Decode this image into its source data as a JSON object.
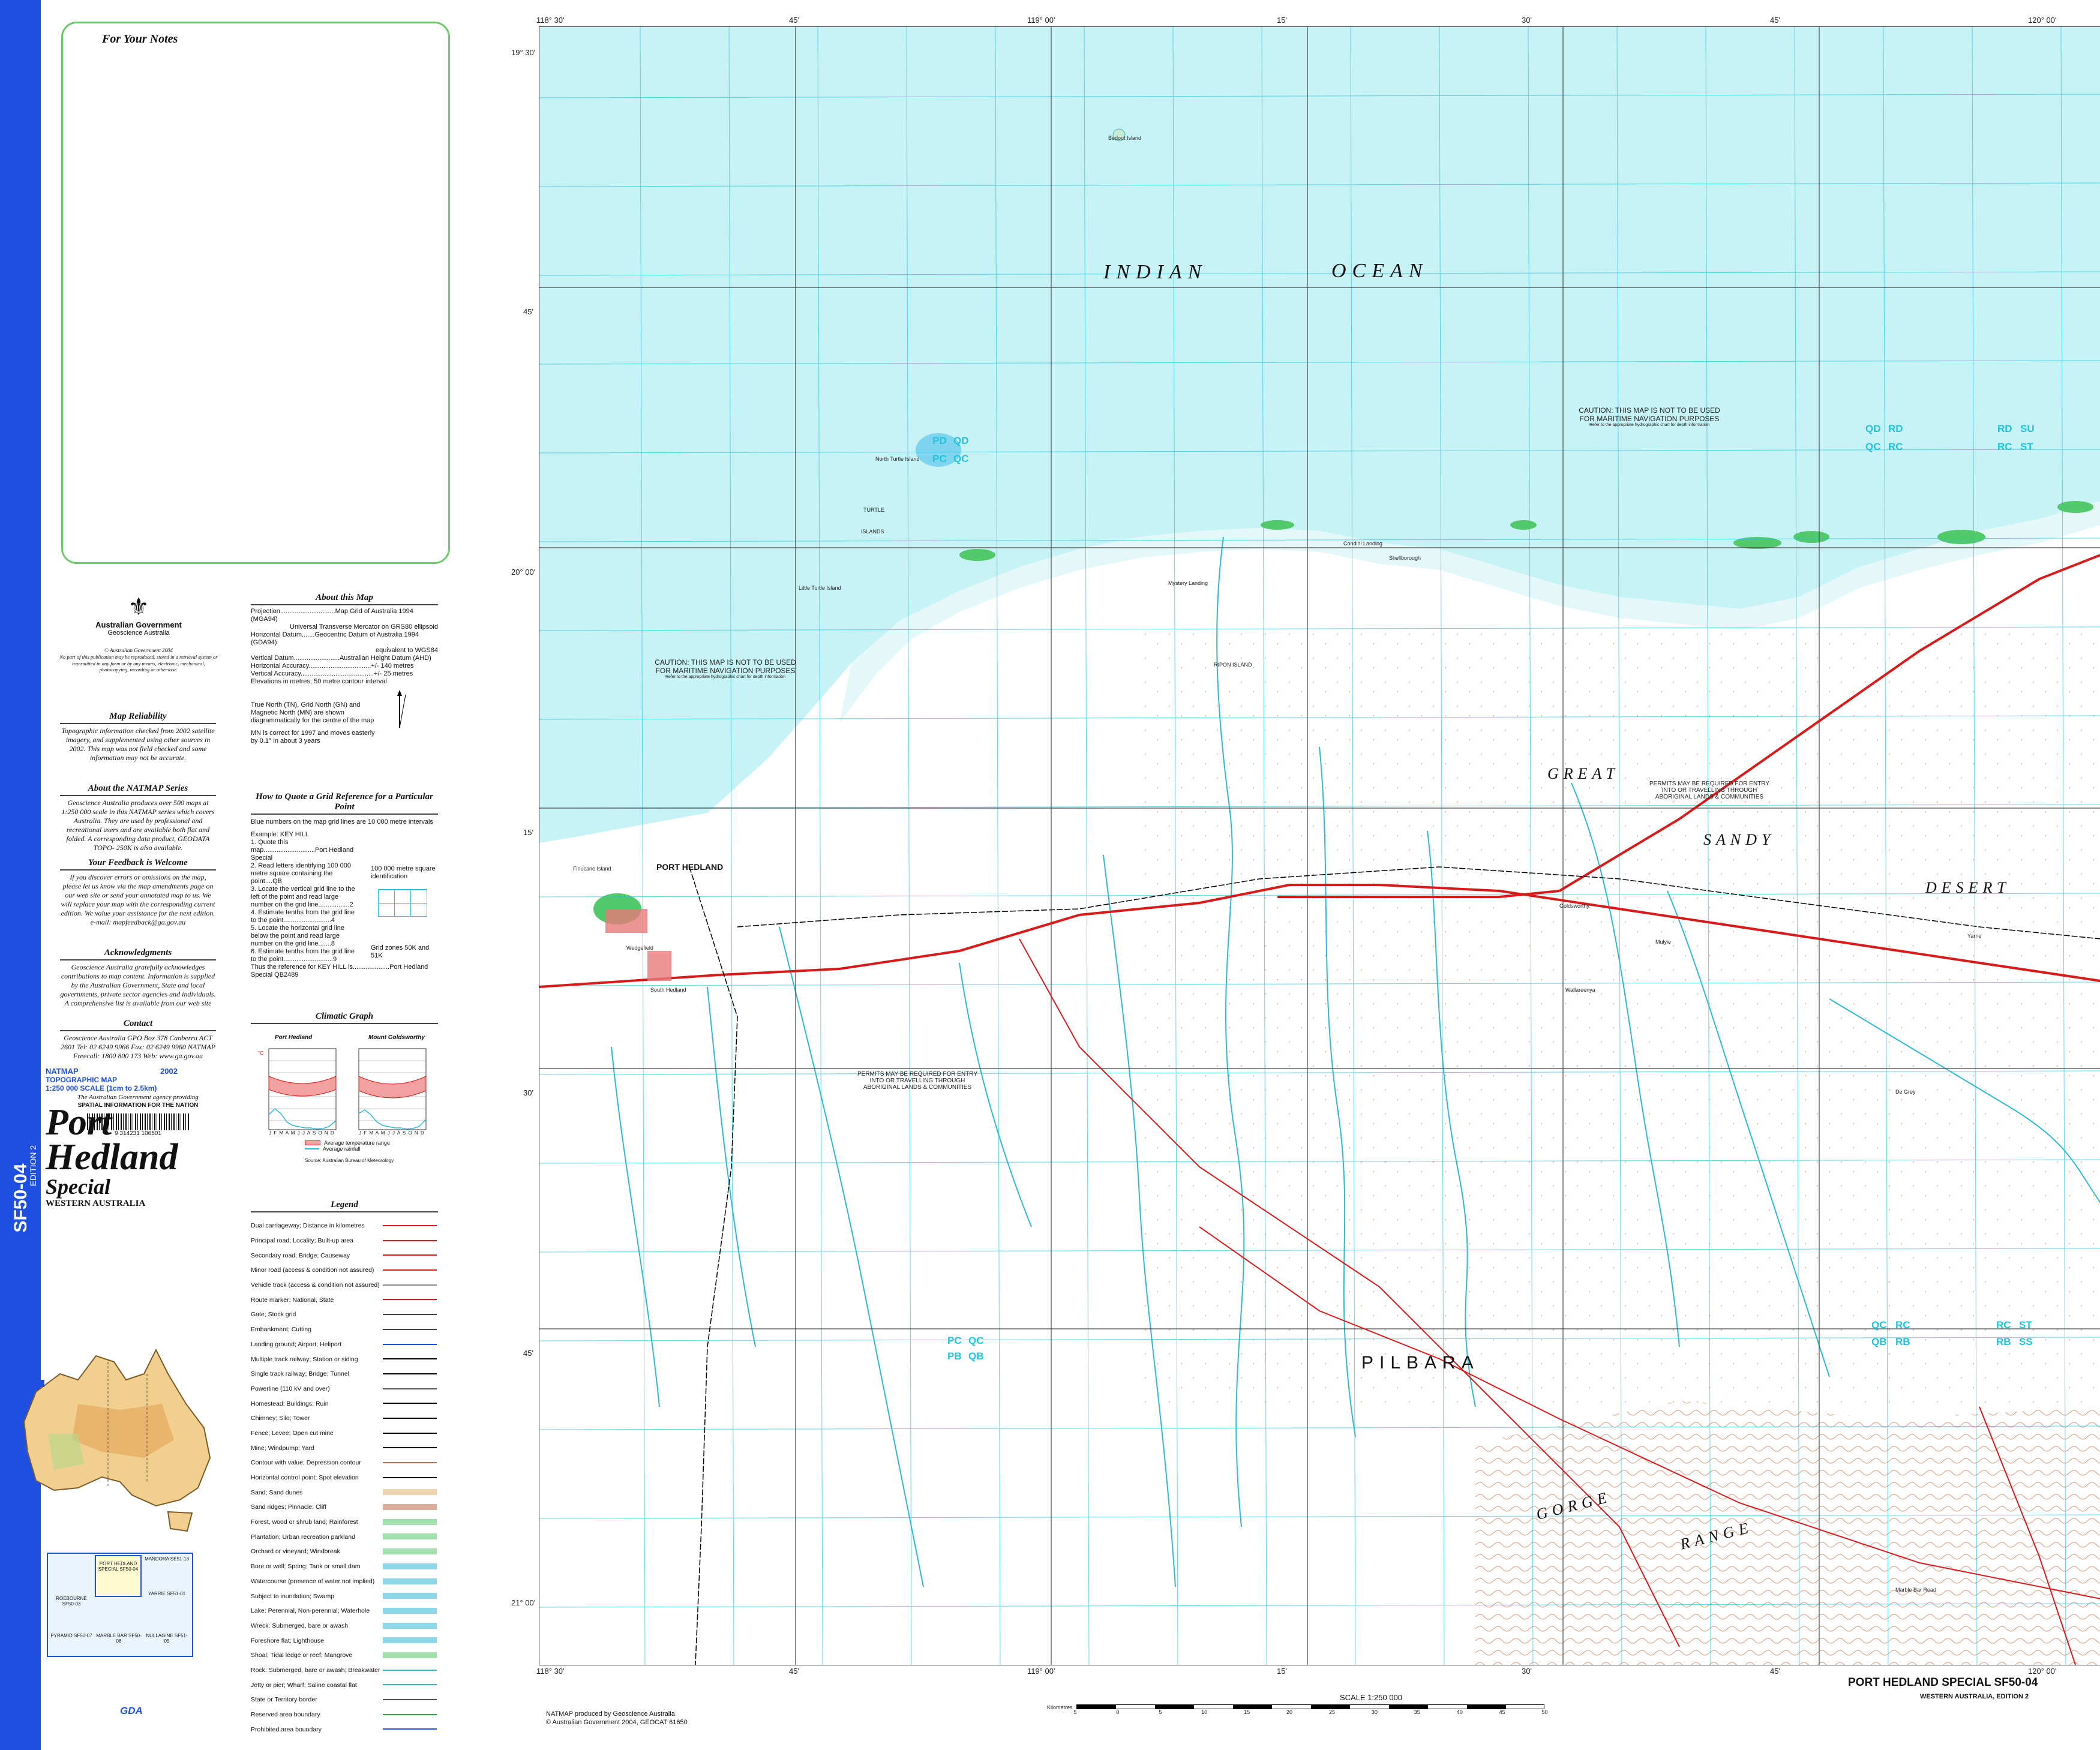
{
  "sheet": {
    "code": "SF50-04",
    "edition": "EDITION 2",
    "series": "NATMAP",
    "map_type": "TOPOGRAPHIC MAP",
    "year": "2002",
    "scale_text": "1:250 000 SCALE (1cm to 2.5km)",
    "title_line1": "Port",
    "title_line2": "Hedland",
    "title_line3": "Special",
    "state": "WESTERN AUSTRALIA",
    "bottom_title": "PORT HEDLAND SPECIAL SF50-04",
    "bottom_subtitle": "WESTERN AUSTRALIA, EDITION 2"
  },
  "notes": {
    "title": "For Your Notes"
  },
  "gov": {
    "line1": "Australian Government",
    "line2": "Geoscience Australia",
    "copyright": "© Australian Government 2004",
    "rights": "No part of this publication may be reproduced, stored in a retrieval system or transmitted in any form or by any means, electronic, mechanical, photocopying, recording or otherwise."
  },
  "panels": [
    {
      "heading": "Map Reliability",
      "body": "Topographic information checked from 2002 satellite imagery, and supplemented using other sources in 2002. This map was not field checked and some information may not be accurate."
    },
    {
      "heading": "About the NATMAP Series",
      "body": "Geoscience Australia produces over 500 maps at 1:250 000 scale in this NATMAP series which covers Australia. They are used by professional and recreational users and are available both flat and folded. A corresponding data product, GEODATA TOPO- 250K is also available."
    },
    {
      "heading": "Your Feedback is Welcome",
      "body": "If you discover errors or omissions on the map, please let us know via the map amendments page on our web site or send your annotated map to us. We will replace your map with the corresponding current edition. We value your assistance for the next edition. e-mail: mapfeedback@ga.gov.au"
    },
    {
      "heading": "Acknowledgments",
      "body": "Geoscience Australia gratefully acknowledges contributions to map content. Information is supplied by the Australian Government, State and local governments, private sector agencies and individuals. A comprehensive list is available from our web site"
    },
    {
      "heading": "Contact",
      "body": "Geoscience Australia GPO Box 378 Canberra ACT 2601 Tel: 02 6249 9966 Fax: 02 6249 9960 NATMAP Freecall: 1800 800 173 Web: www.ga.gov.au"
    }
  ],
  "agency": {
    "line1": "The Australian Government agency providing",
    "line2": "SPATIAL INFORMATION FOR THE NATION",
    "barcode": "9 314231 106501"
  },
  "about": {
    "heading": "About this Map",
    "rows": [
      "Projection..............................Map Grid of Australia 1994 (MGA94)",
      "Universal Transverse Mercator on GRS80 ellipsoid",
      "Horizontal Datum.......Geocentric Datum of Australia 1994 (GDA94)",
      "equivalent to WGS84",
      "Vertical Datum.........................Australian Height Datum (AHD)",
      "Horizontal Accuracy..................................+/- 140 metres",
      "Vertical Accuracy........................................+/- 25 metres",
      "Elevations in metres; 50 metre contour interval"
    ],
    "north_text": "True North (TN), Grid North (GN) and Magnetic North (MN) are shown diagrammatically for the centre of the map",
    "mn_text": "MN is correct for 1997 and moves easterly by 0.1° in about 3 years",
    "grid_conv": "Grid convergence 0.8°",
    "mag_angle": "Grid/Magnetic angle 2.4°"
  },
  "grid_ref": {
    "heading": "How to Quote a Grid Reference for a Particular Point",
    "intro": "Blue numbers on the map grid lines are 10 000 metre intervals",
    "steps": [
      "Example: KEY HILL",
      "1. Quote this map............................Port Hedland Special",
      "2. Read letters identifying 100 000 metre square containing the point....QB",
      "3. Locate the vertical grid line to the left of the point and read large number on the grid line.................2",
      "4. Estimate tenths from the grid line to the point..........................4",
      "5. Locate the horizontal grid line below the point and read large number on the grid line.......8",
      "6. Estimate tenths from the grid line to the point...........................9",
      "Thus the reference for KEY HILL is....................Port Hedland Special QB2489"
    ],
    "square_label": "100 000 metre square identification",
    "zones_label": "Grid zones 50K and 51K"
  },
  "climate": {
    "heading": "Climatic Graph",
    "station1": "Port Hedland",
    "station2": "Mount Goldsworthy",
    "months": "J F M A M J J A S O N D",
    "legend1": "Average temperature range",
    "legend2": "Average rainfall",
    "source": "Source: Australian Bureau of Meteorology"
  },
  "legend": {
    "heading": "Legend",
    "rows": [
      "Dual carriageway; Distance in kilometres",
      "Principal road; Locality; Built-up area",
      "Secondary road; Bridge; Causeway",
      "Minor road (access & condition not assured)",
      "Vehicle track (access & condition not assured)",
      "Route marker: National, State",
      "Gate; Stock grid",
      "Embankment; Cutting",
      "Landing ground; Airport; Heliport",
      "Multiple track railway; Station or siding",
      "Single track railway; Bridge; Tunnel",
      "Powerline (110 kV and over)",
      "Homestead; Buildings; Ruin",
      "Chimney; Silo; Tower",
      "Fence; Levee; Open cut mine",
      "Mine; Windpump; Yard",
      "Contour with value; Depression contour",
      "Horizontal control point; Spot elevation",
      "Sand; Sand dunes",
      "Sand ridges; Pinnacle; Cliff",
      "Forest, wood or shrub land; Rainforest",
      "Plantation; Urban recreation parkland",
      "Orchard or vineyard; Windbreak",
      "Bore or well; Spring; Tank or small dam",
      "Watercourse (presence of water not implied)",
      "Subject to inundation; Swamp",
      "Lake: Perennial, Non-perennial; Waterhole",
      "Wreck: Submerged, bare or awash",
      "Foreshore flat; Lighthouse",
      "Shoal; Tidal ledge or reef; Mangrove",
      "Rock: Submerged, bare or awash; Breakwater",
      "Jetty or pier; Wharf; Saline coastal flat",
      "State or Territory border",
      "Reserved area boundary",
      "Prohibited area boundary"
    ]
  },
  "index_map": {
    "cells": [
      "PORT HEDLAND SPECIAL SF50-04",
      "MANDORA SE51-13",
      "ROEBOURNE SF50-03",
      "YARRIE SF51-01",
      "PYRAMID SF50-07",
      "MARBLE BAR SF50-08",
      "NULLAGINE SF51-05"
    ]
  },
  "gda": "GDA",
  "map": {
    "top_ticks": [
      "118° 30'",
      "45'",
      "119° 00'",
      "15'",
      "30'",
      "45'",
      "120° 00'"
    ],
    "bottom_ticks": [
      "118° 30'",
      "45'",
      "119° 00'",
      "15'",
      "30'",
      "45'",
      "120° 00'"
    ],
    "lat_ticks": [
      "19° 30'",
      "45'",
      "20° 00'",
      "15'",
      "30'",
      "45'",
      "21° 00'"
    ],
    "ocean1": "INDIAN",
    "ocean2": "OCEAN",
    "great": "GREAT",
    "sandy": "SANDY",
    "desert": "DESERT",
    "pilbara": "PILBARA",
    "gorge": "GORGE",
    "range": "RANGE",
    "caution1": "CAUTION: THIS MAP IS NOT TO BE USED",
    "caution2": "FOR MARITIME NAVIGATION PURPOSES",
    "caution_small": "Refer to the appropriate hydrographic chart for depth information",
    "permits1": "PERMITS MAY BE REQUIRED FOR ENTRY",
    "permits2": "INTO OR TRAVELLING THROUGH",
    "permits3": "ABORIGINAL LANDS & COMMUNITIES",
    "town": "PORT HEDLAND",
    "places": [
      "Bedout Island",
      "North Turtle Island",
      "TURTLE",
      "ISLANDS",
      "Little Turtle Island",
      "Mystery Landing",
      "Condini Landing",
      "Shellborough",
      "RIPON ISLAND",
      "Finucane Island",
      "South Hedland",
      "Wedgefield",
      "Goldsworthy",
      "Mulyie",
      "Wallareenya",
      "Yarrie",
      "De Grey",
      "Marble Bar Road"
    ],
    "grid_codes": [
      "PD",
      "QD",
      "PC",
      "QC",
      "QD",
      "RD",
      "QC",
      "RC",
      "RD",
      "SU",
      "RC",
      "ST",
      "PC",
      "QC",
      "PB",
      "QB",
      "QC",
      "RC",
      "QB",
      "RB",
      "RC",
      "ST",
      "RB",
      "SS"
    ]
  },
  "bottom": {
    "prod1": "NATMAP produced by Geoscience Australia",
    "prod2": "© Australian Government 2004, GEOCAT 61650",
    "scale_title": "SCALE 1:250 000",
    "kilometres": "Kilometres",
    "scale_ticks": [
      "5",
      "0",
      "5",
      "10",
      "15",
      "20",
      "25",
      "30",
      "35",
      "40",
      "45",
      "50"
    ]
  },
  "colors": {
    "strip": "#1e4fe0",
    "ocean": "#c8f3f6",
    "land": "#ffffff",
    "road": "#d81a1a",
    "water": "#2fb8d6",
    "grid": "#23c3de",
    "mangrove": "#52c96a"
  }
}
